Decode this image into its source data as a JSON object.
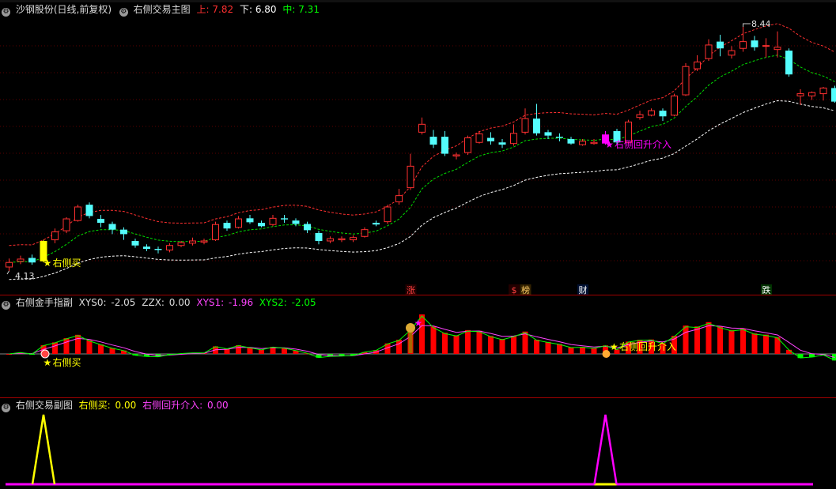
{
  "main": {
    "stock_name": "沙钢股份(日线,前复权)",
    "indicator_name": "右侧交易主图",
    "up_label": "上:",
    "up_value": "7.82",
    "down_label": "下:",
    "down_value": "6.80",
    "mid_label": "中:",
    "mid_value": "7.31",
    "high_marker": "8.44",
    "low_marker": "4.13",
    "buy_label": "右侧买",
    "rebuy_label": "右侧回升介入",
    "event_tags": [
      "涨",
      "$",
      "榜",
      "财",
      "跌"
    ],
    "colors": {
      "up": "#ff3030",
      "down": "#54fcfc",
      "yellow": "#ffff00",
      "magenta": "#ff00ff"
    }
  },
  "sub1": {
    "indicator_name": "右侧金手指副",
    "xys0_label": "XYS0:",
    "xys0_value": "-2.05",
    "zzx_label": "ZZX:",
    "zzx_value": "0.00",
    "xys1_label": "XYS1:",
    "xys1_value": "-1.96",
    "xys2_label": "XYS2:",
    "xys2_value": "-2.05",
    "buy_label": "右侧买",
    "rebuy_label": "右侧回升介入"
  },
  "sub2": {
    "indicator_name": "右侧交易副图",
    "buy_label": "右侧买:",
    "buy_value": "0.00",
    "rebuy_label": "右侧回升介入:",
    "rebuy_value": "0.00"
  },
  "chart_data": {
    "type": "candlestick",
    "candles": [
      {
        "o": 4.2,
        "c": 4.28,
        "h": 4.35,
        "l": 4.13
      },
      {
        "o": 4.3,
        "c": 4.34,
        "h": 4.4,
        "l": 4.25
      },
      {
        "o": 4.36,
        "c": 4.28,
        "h": 4.42,
        "l": 4.24
      },
      {
        "o": 4.3,
        "c": 4.66,
        "h": 4.68,
        "l": 4.28
      },
      {
        "o": 4.68,
        "c": 4.82,
        "h": 4.88,
        "l": 4.62
      },
      {
        "o": 4.84,
        "c": 5.05,
        "h": 5.08,
        "l": 4.8
      },
      {
        "o": 5.02,
        "c": 5.26,
        "h": 5.3,
        "l": 5.0
      },
      {
        "o": 5.3,
        "c": 5.1,
        "h": 5.34,
        "l": 5.06
      },
      {
        "o": 5.05,
        "c": 4.98,
        "h": 5.12,
        "l": 4.9
      },
      {
        "o": 4.96,
        "c": 4.86,
        "h": 5.0,
        "l": 4.78
      },
      {
        "o": 4.86,
        "c": 4.78,
        "h": 4.9,
        "l": 4.68
      },
      {
        "o": 4.66,
        "c": 4.58,
        "h": 4.7,
        "l": 4.54
      },
      {
        "o": 4.56,
        "c": 4.52,
        "h": 4.6,
        "l": 4.48
      },
      {
        "o": 4.52,
        "c": 4.5,
        "h": 4.56,
        "l": 4.44
      },
      {
        "o": 4.5,
        "c": 4.58,
        "h": 4.62,
        "l": 4.46
      },
      {
        "o": 4.58,
        "c": 4.63,
        "h": 4.66,
        "l": 4.55
      },
      {
        "o": 4.62,
        "c": 4.66,
        "h": 4.72,
        "l": 4.58
      },
      {
        "o": 4.64,
        "c": 4.66,
        "h": 4.7,
        "l": 4.6
      },
      {
        "o": 4.68,
        "c": 4.95,
        "h": 5.0,
        "l": 4.66
      },
      {
        "o": 4.98,
        "c": 4.88,
        "h": 5.02,
        "l": 4.84
      },
      {
        "o": 4.9,
        "c": 5.05,
        "h": 5.1,
        "l": 4.88
      },
      {
        "o": 5.06,
        "c": 4.99,
        "h": 5.12,
        "l": 4.96
      },
      {
        "o": 4.98,
        "c": 4.92,
        "h": 5.02,
        "l": 4.9
      },
      {
        "o": 4.95,
        "c": 5.06,
        "h": 5.12,
        "l": 4.92
      },
      {
        "o": 5.06,
        "c": 5.04,
        "h": 5.12,
        "l": 4.98
      },
      {
        "o": 5.02,
        "c": 4.96,
        "h": 5.06,
        "l": 4.92
      },
      {
        "o": 4.96,
        "c": 4.85,
        "h": 5.0,
        "l": 4.8
      },
      {
        "o": 4.8,
        "c": 4.66,
        "h": 4.84,
        "l": 4.6
      },
      {
        "o": 4.66,
        "c": 4.7,
        "h": 4.74,
        "l": 4.62
      },
      {
        "o": 4.68,
        "c": 4.7,
        "h": 4.74,
        "l": 4.64
      },
      {
        "o": 4.68,
        "c": 4.72,
        "h": 4.76,
        "l": 4.64
      },
      {
        "o": 4.74,
        "c": 4.86,
        "h": 4.9,
        "l": 4.72
      },
      {
        "o": 4.98,
        "c": 4.95,
        "h": 5.02,
        "l": 4.92
      },
      {
        "o": 5.0,
        "c": 5.26,
        "h": 5.3,
        "l": 4.96
      },
      {
        "o": 5.35,
        "c": 5.46,
        "h": 5.58,
        "l": 5.3
      },
      {
        "o": 5.6,
        "c": 5.98,
        "h": 6.2,
        "l": 5.56
      },
      {
        "o": 6.58,
        "c": 6.72,
        "h": 6.84,
        "l": 6.54
      },
      {
        "o": 6.5,
        "c": 6.36,
        "h": 6.62,
        "l": 6.3
      },
      {
        "o": 6.5,
        "c": 6.2,
        "h": 6.6,
        "l": 6.16
      },
      {
        "o": 6.16,
        "c": 6.18,
        "h": 6.22,
        "l": 6.1
      },
      {
        "o": 6.22,
        "c": 6.48,
        "h": 6.52,
        "l": 6.18
      },
      {
        "o": 6.4,
        "c": 6.55,
        "h": 6.6,
        "l": 6.38
      },
      {
        "o": 6.48,
        "c": 6.42,
        "h": 6.58,
        "l": 6.36
      },
      {
        "o": 6.4,
        "c": 6.36,
        "h": 6.46,
        "l": 6.3
      },
      {
        "o": 6.38,
        "c": 6.56,
        "h": 6.72,
        "l": 6.34
      },
      {
        "o": 6.58,
        "c": 6.82,
        "h": 7.0,
        "l": 6.54
      },
      {
        "o": 6.82,
        "c": 6.56,
        "h": 7.08,
        "l": 6.52
      },
      {
        "o": 6.58,
        "c": 6.52,
        "h": 6.62,
        "l": 6.46
      },
      {
        "o": 6.5,
        "c": 6.48,
        "h": 6.56,
        "l": 6.42
      },
      {
        "o": 6.46,
        "c": 6.38,
        "h": 6.5,
        "l": 6.36
      },
      {
        "o": 6.36,
        "c": 6.42,
        "h": 6.46,
        "l": 6.34
      },
      {
        "o": 6.38,
        "c": 6.4,
        "h": 6.46,
        "l": 6.36
      },
      {
        "o": 6.38,
        "c": 6.54,
        "h": 6.6,
        "l": 6.36
      },
      {
        "o": 6.6,
        "c": 6.4,
        "h": 6.64,
        "l": 6.36
      },
      {
        "o": 6.4,
        "c": 6.76,
        "h": 6.8,
        "l": 6.38
      },
      {
        "o": 6.84,
        "c": 6.89,
        "h": 6.96,
        "l": 6.8
      },
      {
        "o": 6.88,
        "c": 6.96,
        "h": 7.0,
        "l": 6.86
      },
      {
        "o": 6.96,
        "c": 6.86,
        "h": 7.0,
        "l": 6.78
      },
      {
        "o": 6.88,
        "c": 7.22,
        "h": 7.26,
        "l": 6.86
      },
      {
        "o": 7.24,
        "c": 7.74,
        "h": 7.8,
        "l": 7.22
      },
      {
        "o": 7.7,
        "c": 7.82,
        "h": 7.94,
        "l": 7.66
      },
      {
        "o": 7.88,
        "c": 8.12,
        "h": 8.22,
        "l": 7.84
      },
      {
        "o": 8.18,
        "c": 8.06,
        "h": 8.3,
        "l": 7.92
      },
      {
        "o": 7.94,
        "c": 8.02,
        "h": 8.1,
        "l": 7.88
      },
      {
        "o": 8.06,
        "c": 8.18,
        "h": 8.44,
        "l": 8.0
      },
      {
        "o": 8.2,
        "c": 8.08,
        "h": 8.28,
        "l": 8.02
      },
      {
        "o": 8.1,
        "c": 8.11,
        "h": 8.24,
        "l": 7.9
      },
      {
        "o": 8.04,
        "c": 8.08,
        "h": 8.36,
        "l": 7.9
      },
      {
        "o": 8.02,
        "c": 7.6,
        "h": 8.06,
        "l": 7.56
      },
      {
        "o": 7.22,
        "c": 7.26,
        "h": 7.34,
        "l": 7.06
      },
      {
        "o": 7.22,
        "c": 7.28,
        "h": 7.3,
        "l": 7.15
      },
      {
        "o": 7.26,
        "c": 7.36,
        "h": 7.38,
        "l": 7.14
      },
      {
        "o": 7.36,
        "c": 7.12,
        "h": 7.4,
        "l": 7.1
      }
    ],
    "ylim": [
      4.13,
      8.44
    ],
    "buy_bars": [
      3
    ],
    "rebuy_bars": [
      52
    ]
  }
}
